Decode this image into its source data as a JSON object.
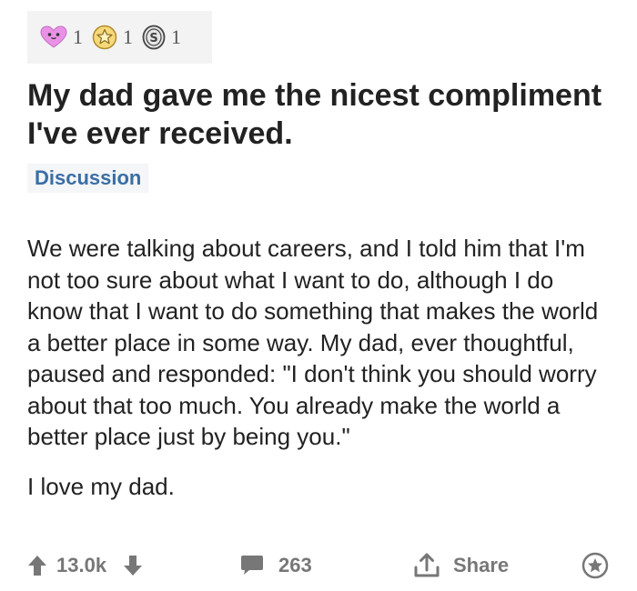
{
  "awards": [
    {
      "name": "wholesome-award",
      "icon": "heart-face-icon",
      "count": "1"
    },
    {
      "name": "gold-award",
      "icon": "gold-star-icon",
      "count": "1"
    },
    {
      "name": "silver-award",
      "icon": "silver-coin-icon",
      "count": "1"
    }
  ],
  "post": {
    "title": "My dad gave me the nicest compliment I've ever received.",
    "flair": "Discussion",
    "paragraphs": [
      "We were talking about careers, and I told him that I'm not too sure about what I want to do, although I do know that I want to do something that makes the world a better place in some way. My dad, ever thoughtful, paused and responded: \"I don't think you should worry about that too much. You already make the world a better place just by being you.\"",
      "I love my dad."
    ]
  },
  "actions": {
    "upvotes": "13.0k",
    "comments": "263",
    "share_label": "Share"
  },
  "colors": {
    "flair_text": "#3a6ea5",
    "action_gray": "#777777",
    "award_heart": "#e891e6",
    "award_gold": "#f2c94c"
  }
}
